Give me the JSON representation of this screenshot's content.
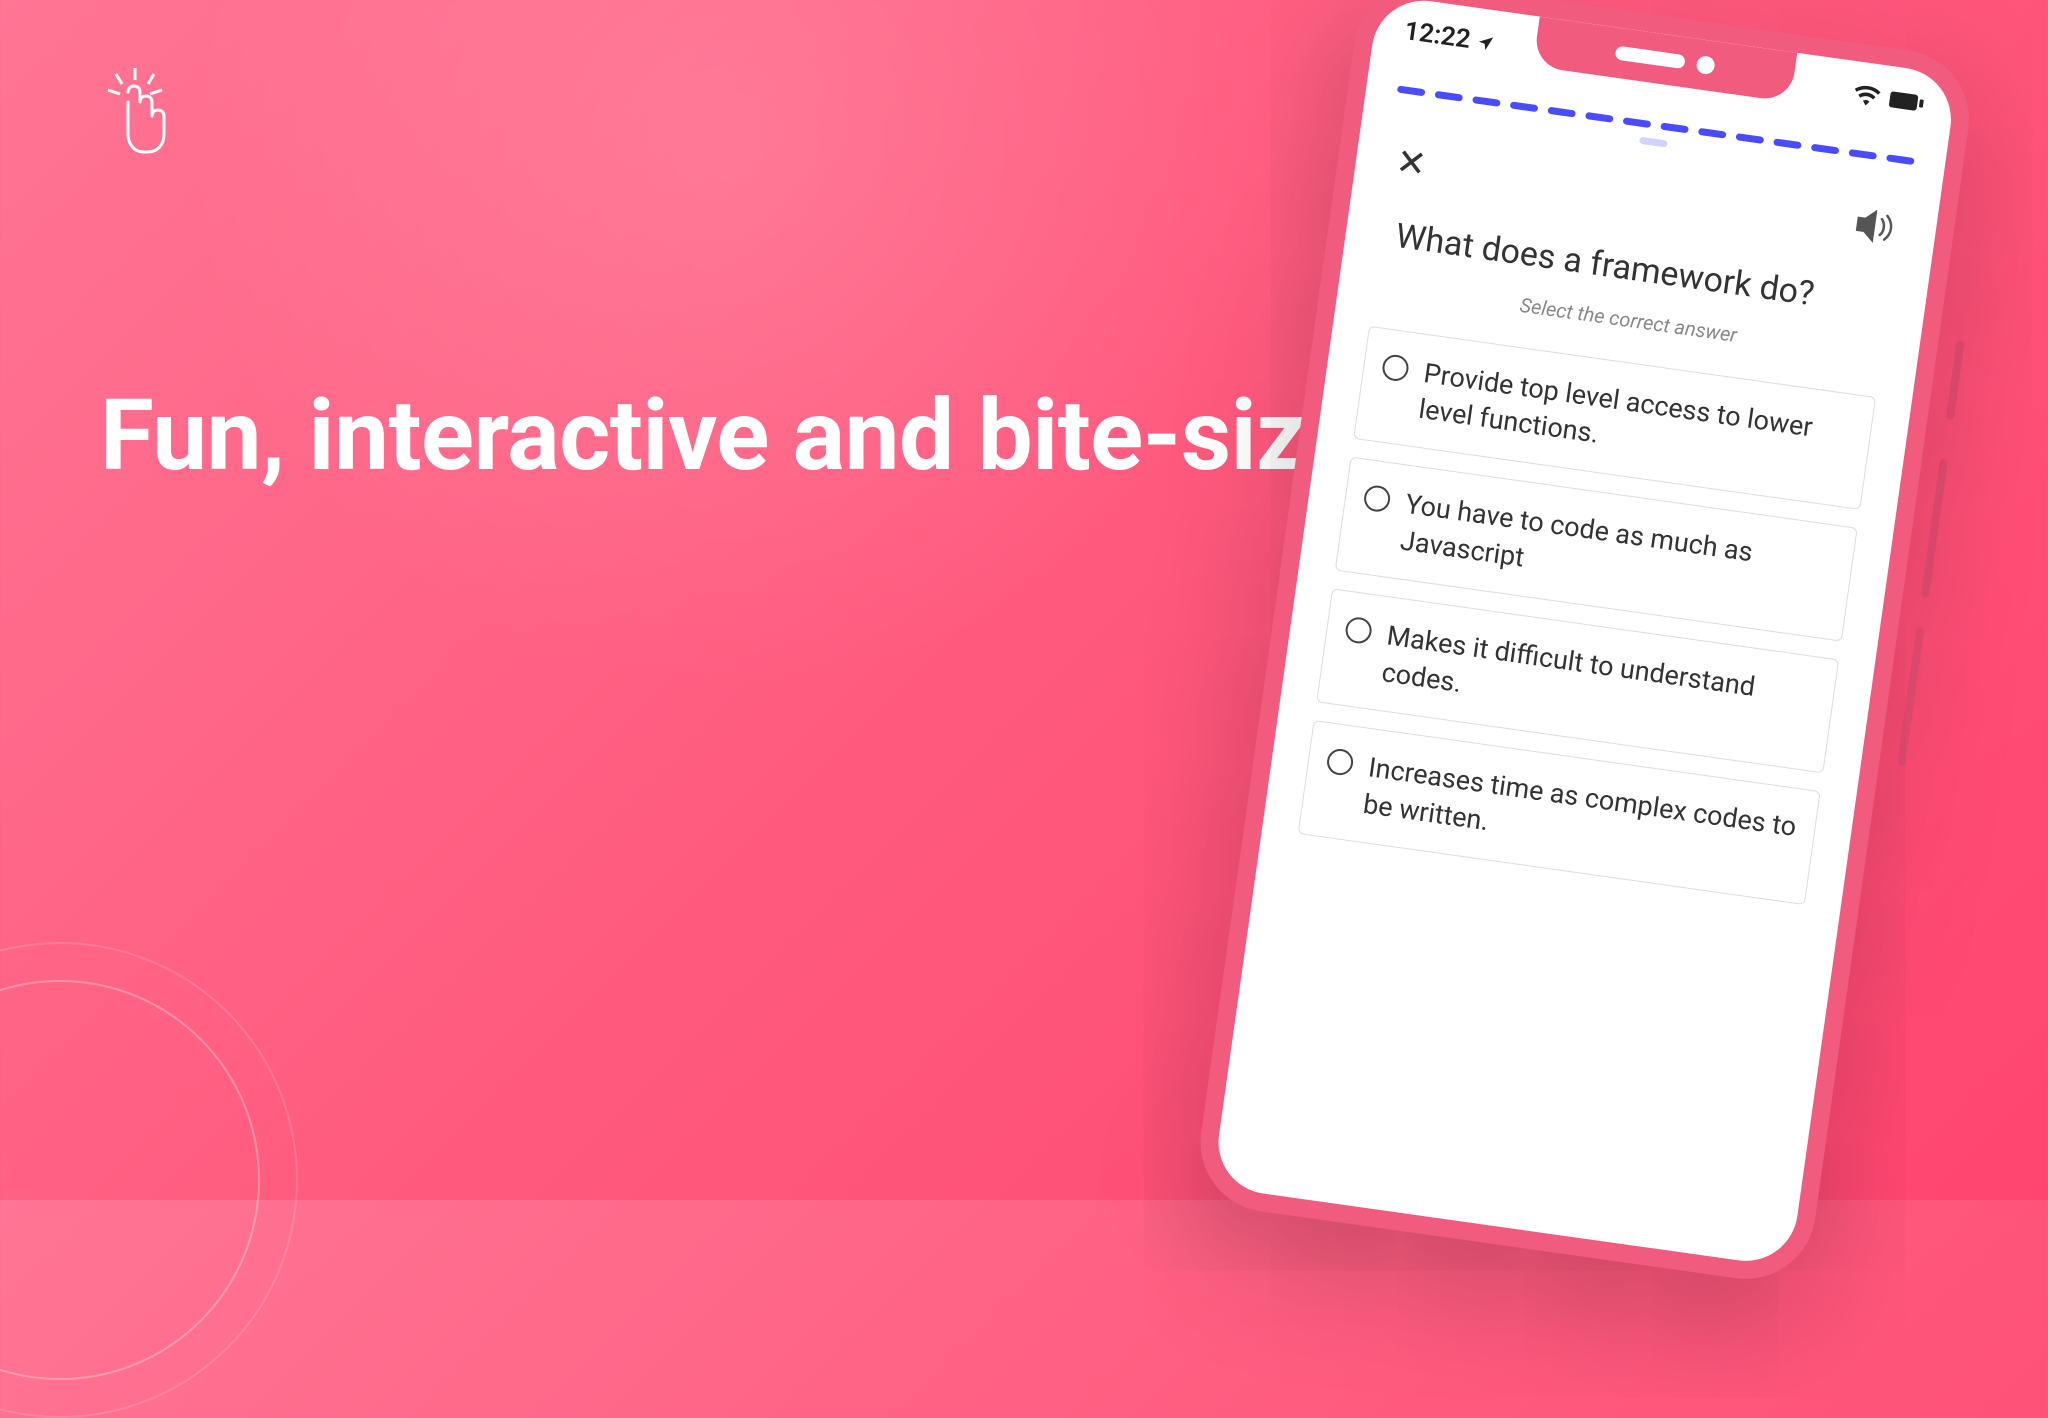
{
  "headline": "Fun, interactive and bite-sized learning",
  "phone": {
    "time": "12:22",
    "progress_total": 15,
    "progress_done": 14,
    "question": "What does a framework do?",
    "subtext": "Select the correct answer",
    "options": [
      "Provide top level access to lower level functions.",
      "You have to code as much as Javascript",
      "Makes it difficult to understand codes.",
      "Increases time as complex codes to be written."
    ]
  }
}
